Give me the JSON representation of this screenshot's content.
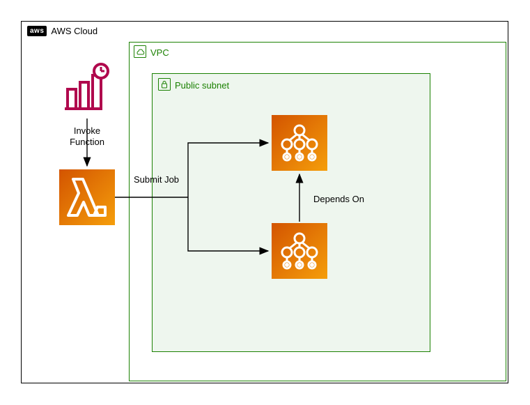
{
  "cloud": {
    "label": "AWS Cloud"
  },
  "vpc": {
    "label": "VPC"
  },
  "subnet": {
    "label": "Public subnet"
  },
  "labels": {
    "invoke": "Invoke\nFunction",
    "submit": "Submit Job",
    "depends": "Depends On"
  },
  "icons": {
    "aws": "aws",
    "cloudwatch": "cloudwatch-scheduled-event-icon",
    "lambda": "lambda-icon",
    "batch1": "batch-job-icon",
    "batch2": "batch-job-icon",
    "vpc": "vpc-icon",
    "subnet": "subnet-lock-icon"
  },
  "colors": {
    "orange_dark": "#d35400",
    "orange_light": "#f39c12",
    "magenta": "#b0084d",
    "green": "#1b8102",
    "subnet_bg": "#eef6ee"
  }
}
